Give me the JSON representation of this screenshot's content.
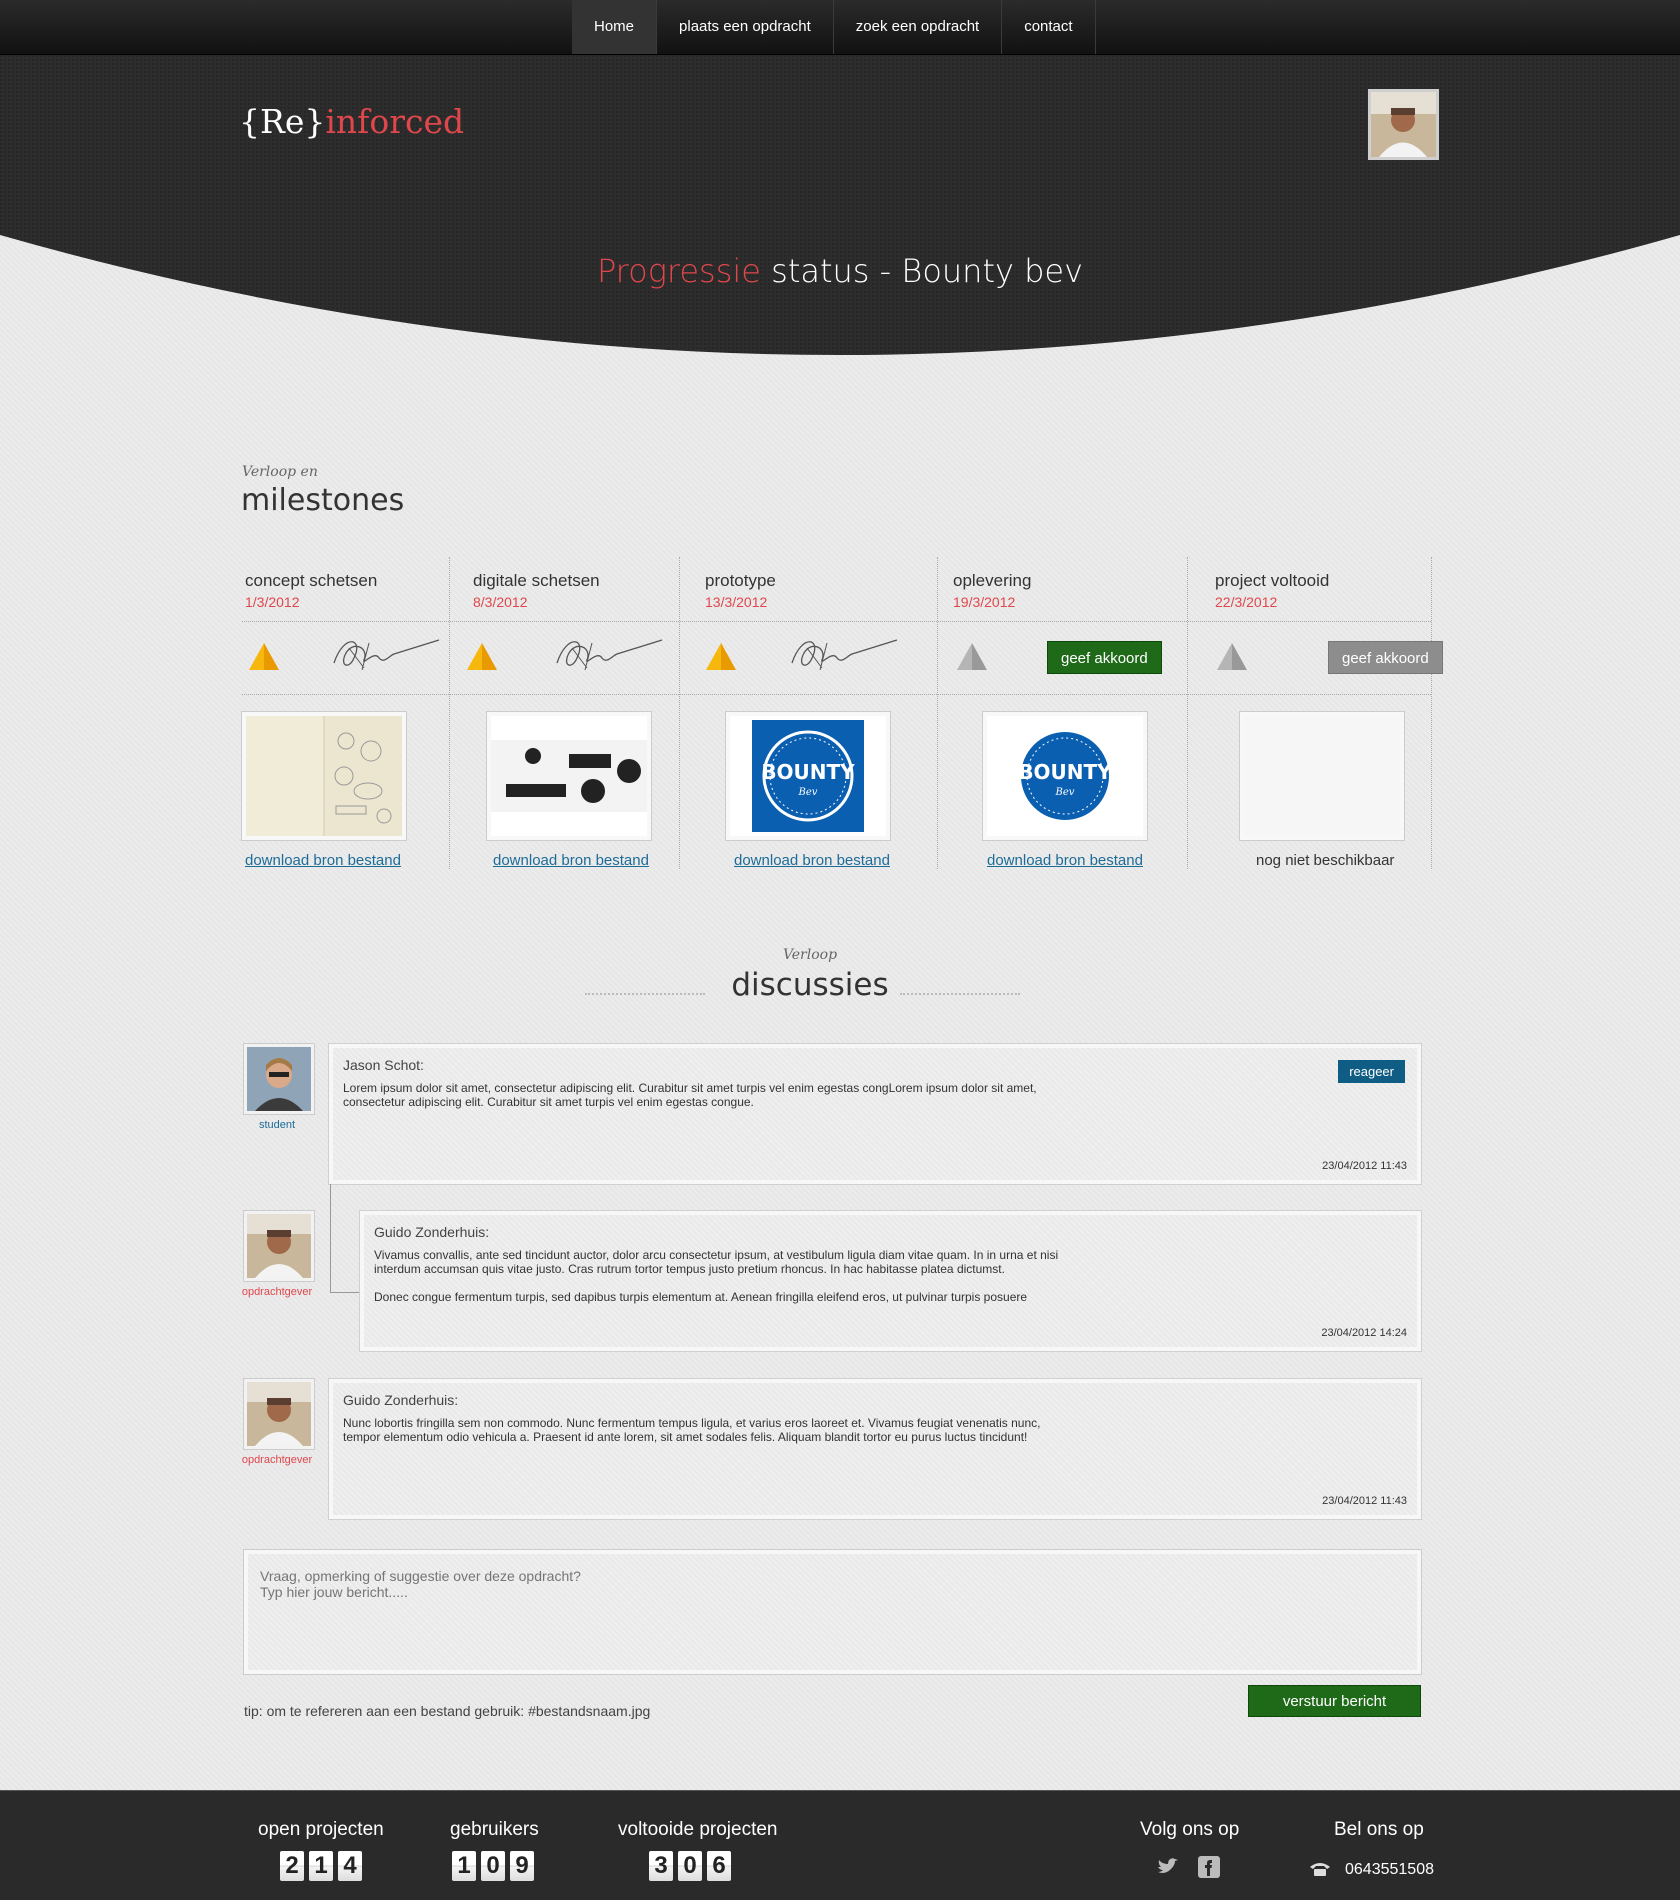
{
  "nav": {
    "items": [
      {
        "label": "Home",
        "active": true
      },
      {
        "label": "plaats een opdracht",
        "active": false
      },
      {
        "label": "zoek een opdracht",
        "active": false
      },
      {
        "label": "contact",
        "active": false
      }
    ]
  },
  "header": {
    "logo_prefix": "{Re}",
    "logo_suffix": "inforced",
    "title_highlight": "Progressie",
    "title_rest": " status - Bounty bev"
  },
  "milestones": {
    "subtitle": "Verloop en",
    "title": "milestones",
    "items": [
      {
        "name": "concept schetsen",
        "date": "1/3/2012",
        "status": "approved",
        "link": "download bron bestand"
      },
      {
        "name": "digitale schetsen",
        "date": "8/3/2012",
        "status": "approved",
        "link": "download bron bestand"
      },
      {
        "name": "prototype",
        "date": "13/3/2012",
        "status": "approved",
        "link": "download bron bestand"
      },
      {
        "name": "oplevering",
        "date": "19/3/2012",
        "status": "pending",
        "button": "geef akkoord",
        "link": "download bron bestand"
      },
      {
        "name": "project voltooid",
        "date": "22/3/2012",
        "status": "disabled",
        "button": "geef akkoord",
        "unavailable": "nog niet beschikbaar"
      }
    ],
    "thumbnail_text": {
      "bounty": "BOUNTY",
      "bev": "Bev"
    }
  },
  "discussions": {
    "subtitle": "Verloop",
    "title": "discussies",
    "comments": [
      {
        "author": "Jason Schot:",
        "role": "student",
        "body": "Lorem ipsum dolor sit amet, consectetur adipiscing elit. Curabitur sit amet turpis vel enim egestas congLorem ipsum dolor sit amet,\nconsectetur adipiscing elit. Curabitur sit amet turpis vel enim egestas congue.",
        "time": "23/04/2012 11:43",
        "reply_label": "reageer"
      },
      {
        "author": "Guido Zonderhuis:",
        "role": "opdrachtgever",
        "body": "Vivamus convallis, ante sed tincidunt auctor, dolor arcu consectetur ipsum, at vestibulum ligula diam vitae quam. In in urna et nisi\ninterdum accumsan quis vitae justo. Cras rutrum tortor tempus justo pretium rhoncus. In hac habitasse platea dictumst.\n\nDonec congue fermentum turpis, sed dapibus turpis elementum at. Aenean fringilla eleifend eros, ut pulvinar turpis posuere",
        "time": "23/04/2012 14:24"
      },
      {
        "author": "Guido Zonderhuis:",
        "role": "opdrachtgever",
        "body": "Nunc lobortis fringilla sem non commodo. Nunc fermentum tempus ligula, et varius eros laoreet et. Vivamus feugiat venenatis nunc,\ntempor elementum odio vehicula a. Praesent id ante lorem, sit amet sodales felis. Aliquam blandit tortor eu purus luctus tincidunt!",
        "time": "23/04/2012 11:43"
      }
    ],
    "message_placeholder": "Vraag, opmerking of suggestie over deze opdracht?\nTyp hier jouw bericht.....",
    "send_label": "verstuur bericht",
    "tip": "tip: om te refereren aan een bestand gebruik:  #bestandsnaam.jpg"
  },
  "footer": {
    "open_projects_label": "open projecten",
    "open_projects_digits": [
      "2",
      "1",
      "4"
    ],
    "users_label": "gebruikers",
    "users_digits": [
      "1",
      "0",
      "9"
    ],
    "completed_label": "voltooide projecten",
    "completed_digits": [
      "3",
      "0",
      "6"
    ],
    "follow_label": "Volg ons op",
    "call_label": "Bel ons op",
    "phone": "0643551508"
  },
  "colors": {
    "accent_red": "#e0474c",
    "green_button": "#1e6a18",
    "reply_blue": "#0f5c85",
    "link_blue": "#1d6c98",
    "dark_header": "#2a2a2a"
  },
  "icons": [
    "approved-pyramid-icon",
    "pending-pyramid-icon",
    "signature-icon",
    "twitter-icon",
    "facebook-icon",
    "phone-icon"
  ]
}
